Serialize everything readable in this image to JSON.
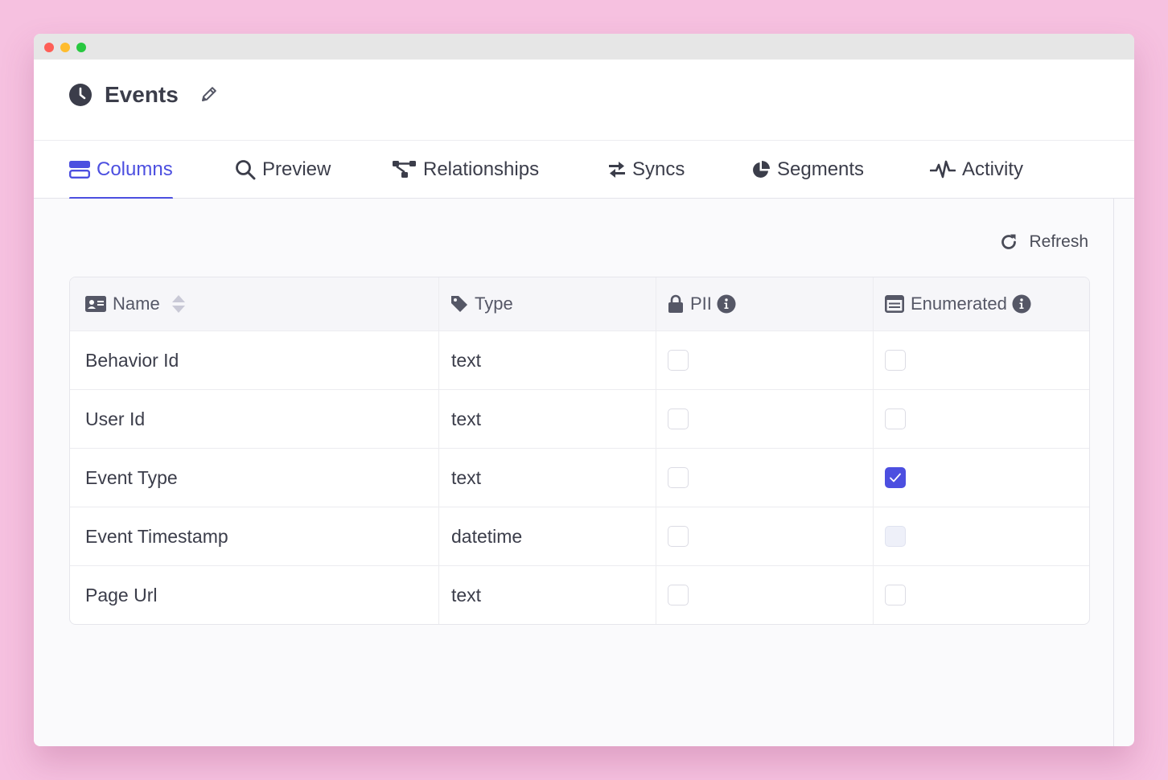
{
  "window": {
    "title": "Events"
  },
  "tabs": [
    {
      "label": "Columns",
      "icon": "columns-icon",
      "active": true
    },
    {
      "label": "Preview",
      "icon": "search-icon",
      "active": false
    },
    {
      "label": "Relationships",
      "icon": "relationships-icon",
      "active": false
    },
    {
      "label": "Syncs",
      "icon": "syncs-icon",
      "active": false
    },
    {
      "label": "Segments",
      "icon": "pie-chart-icon",
      "active": false
    },
    {
      "label": "Activity",
      "icon": "pulse-icon",
      "active": false
    }
  ],
  "toolbar": {
    "refresh_label": "Refresh"
  },
  "table": {
    "headers": {
      "name": "Name",
      "type": "Type",
      "pii": "PII",
      "enumerated": "Enumerated"
    },
    "rows": [
      {
        "name": "Behavior Id",
        "type": "text",
        "pii": false,
        "enumerated": false,
        "enumerated_disabled": false
      },
      {
        "name": "User Id",
        "type": "text",
        "pii": false,
        "enumerated": false,
        "enumerated_disabled": false
      },
      {
        "name": "Event Type",
        "type": "text",
        "pii": false,
        "enumerated": true,
        "enumerated_disabled": false
      },
      {
        "name": "Event Timestamp",
        "type": "datetime",
        "pii": false,
        "enumerated": false,
        "enumerated_disabled": true
      },
      {
        "name": "Page Url",
        "type": "text",
        "pii": false,
        "enumerated": false,
        "enumerated_disabled": false
      }
    ]
  },
  "colors": {
    "accent": "#4c4fe0",
    "background": "#f6c1e0",
    "text": "#3b3d4a"
  }
}
